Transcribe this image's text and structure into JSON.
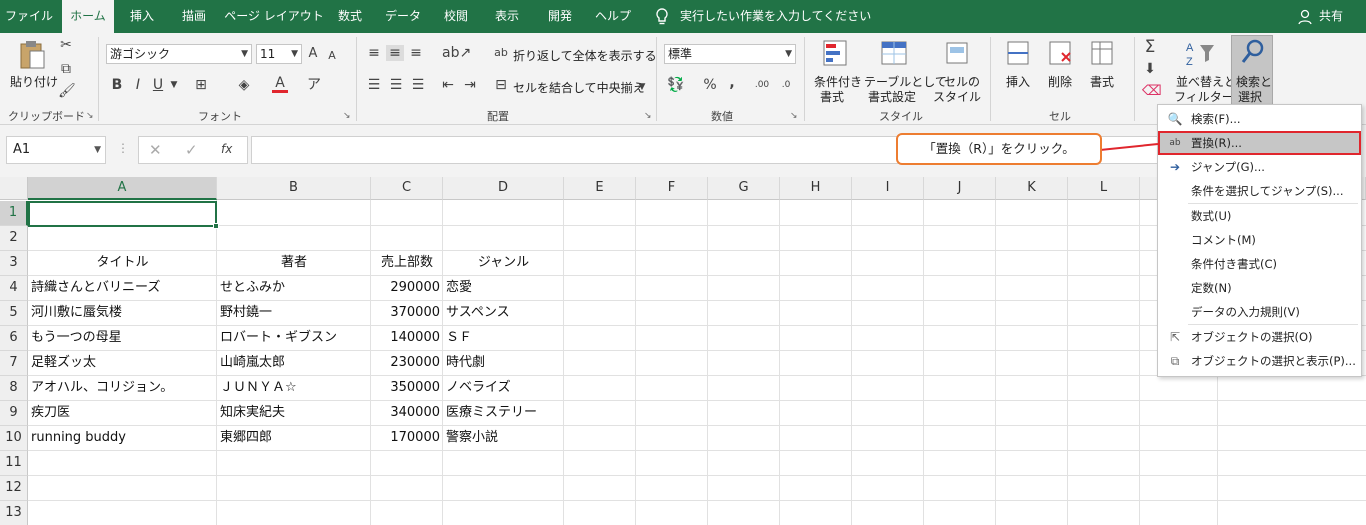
{
  "menu": {
    "tabs": [
      "ファイル",
      "ホーム",
      "挿入",
      "描画",
      "ページ レイアウト",
      "数式",
      "データ",
      "校閲",
      "表示",
      "開発",
      "ヘルプ"
    ],
    "active_tab": "ホーム",
    "tell_me": "実行したい作業を入力してください",
    "share": "共有"
  },
  "ribbon": {
    "clipboard": {
      "paste": "貼り付け",
      "label": "クリップボード"
    },
    "font": {
      "name": "游ゴシック",
      "size": "11",
      "bold": "B",
      "italic": "I",
      "underline": "U",
      "grow": "A",
      "shrink": "A",
      "font_color": "A",
      "label": "フォント"
    },
    "alignment": {
      "wrap": "折り返して全体を表示する",
      "merge": "セルを結合して中央揃え",
      "label": "配置"
    },
    "number": {
      "format": "標準",
      "percent": "%",
      "comma": ",",
      "label": "数値"
    },
    "styles": {
      "conditional_1": "条件付き",
      "conditional_2": "書式",
      "table_1": "テーブルとして",
      "table_2": "書式設定",
      "cell_1": "セルの",
      "cell_2": "スタイル",
      "label": "スタイル"
    },
    "cells": {
      "insert": "挿入",
      "delete": "削除",
      "format": "書式",
      "label": "セル"
    },
    "editing": {
      "sort_1": "並べ替えと",
      "sort_2": "フィルター",
      "find_1": "検索と",
      "find_2": "選択",
      "sum": "Σ"
    }
  },
  "formula_bar": {
    "name_box": "A1",
    "fx": "fx",
    "value": ""
  },
  "columns": [
    "A",
    "B",
    "C",
    "D",
    "E",
    "F",
    "G",
    "H",
    "I",
    "J",
    "K",
    "L"
  ],
  "rows": [
    "1",
    "2",
    "3",
    "4",
    "5",
    "6",
    "7",
    "8",
    "9",
    "10",
    "11",
    "12",
    "13"
  ],
  "table": {
    "headers": [
      "タイトル",
      "著者",
      "売上部数",
      "ジャンル"
    ],
    "data": [
      [
        "詩織さんとバリニーズ",
        "せとふみか",
        "290000",
        "恋愛"
      ],
      [
        "河川敷に蜃気楼",
        "野村鐃一",
        "370000",
        "サスペンス"
      ],
      [
        "もう一つの母星",
        "ロバート・ギブスン",
        "140000",
        "ＳＦ"
      ],
      [
        "足軽ズッ太",
        "山崎嵐太郎",
        "230000",
        "時代劇"
      ],
      [
        "アオハル、コリジョン。",
        "ＪＵＮＹＡ☆",
        "350000",
        "ノベライズ"
      ],
      [
        "疾刀医",
        "知床実紀夫",
        "340000",
        "医療ミステリー"
      ],
      [
        "running buddy",
        "東郷四郎",
        "170000",
        "警察小説"
      ]
    ]
  },
  "dropdown": {
    "items": [
      {
        "label": "検索(F)...",
        "icon": "search-icon"
      },
      {
        "label": "置換(R)...",
        "icon": "replace-icon",
        "highlighted": true
      },
      {
        "label": "ジャンプ(G)...",
        "icon": "arrow-right-icon"
      },
      {
        "label": "条件を選択してジャンプ(S)...",
        "icon": ""
      },
      {
        "label": "数式(U)",
        "icon": ""
      },
      {
        "label": "コメント(M)",
        "icon": ""
      },
      {
        "label": "条件付き書式(C)",
        "icon": ""
      },
      {
        "label": "定数(N)",
        "icon": ""
      },
      {
        "label": "データの入力規則(V)",
        "icon": ""
      },
      {
        "label": "オブジェクトの選択(O)",
        "icon": "pointer-icon"
      },
      {
        "label": "オブジェクトの選択と表示(P)...",
        "icon": "objects-icon"
      }
    ]
  },
  "callout": {
    "text": "「置換（R）」をクリック。"
  },
  "colors": {
    "excel_green": "#217346",
    "callout_border": "#ed7d31",
    "highlight_border": "#e0262d"
  }
}
